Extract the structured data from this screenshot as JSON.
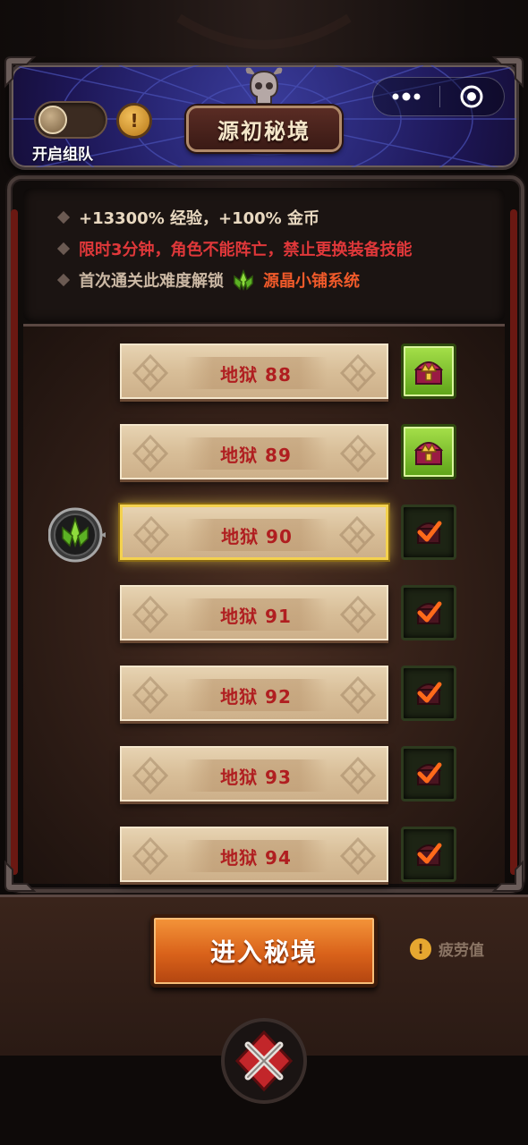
{
  "header": {
    "title": "源初秘境",
    "team_toggle_label": "开启组队",
    "team_toggle_on": false,
    "info_icon": "exclamation-icon",
    "capsule_menu_icon": "more-dots-icon",
    "capsule_close_icon": "target-close-icon"
  },
  "info": {
    "lines": [
      {
        "text": "+13300% 经验，+100% 金币",
        "color": "#e8d8c0"
      },
      {
        "text": "限时3分钟，角色不能阵亡，禁止更换装备技能",
        "color": "#e0383a"
      },
      {
        "text_before": "首次通关此难度解锁",
        "icon": "green-crystal-icon",
        "text_after": "源晶小铺系统",
        "color_before": "#cbb8a4",
        "color_after": "#f05a2a"
      }
    ]
  },
  "levels": [
    {
      "label": "地狱 88",
      "reward": "chest",
      "selected": false
    },
    {
      "label": "地狱 89",
      "reward": "chest",
      "selected": false
    },
    {
      "label": "地狱 90",
      "reward": "claimed",
      "selected": true
    },
    {
      "label": "地狱 91",
      "reward": "claimed",
      "selected": false
    },
    {
      "label": "地狱 92",
      "reward": "claimed",
      "selected": false
    },
    {
      "label": "地狱 93",
      "reward": "claimed",
      "selected": false
    },
    {
      "label": "地狱 94",
      "reward": "claimed",
      "selected": false
    }
  ],
  "actions": {
    "enter_button": "进入秘境",
    "fatigue_label": "疲劳值",
    "fatigue_icon": "!"
  },
  "colors": {
    "level_text": "#b01e20",
    "selected_border": "#f4d24e",
    "chest_bg": "#7ac42a",
    "enter_button": "#e27024"
  }
}
